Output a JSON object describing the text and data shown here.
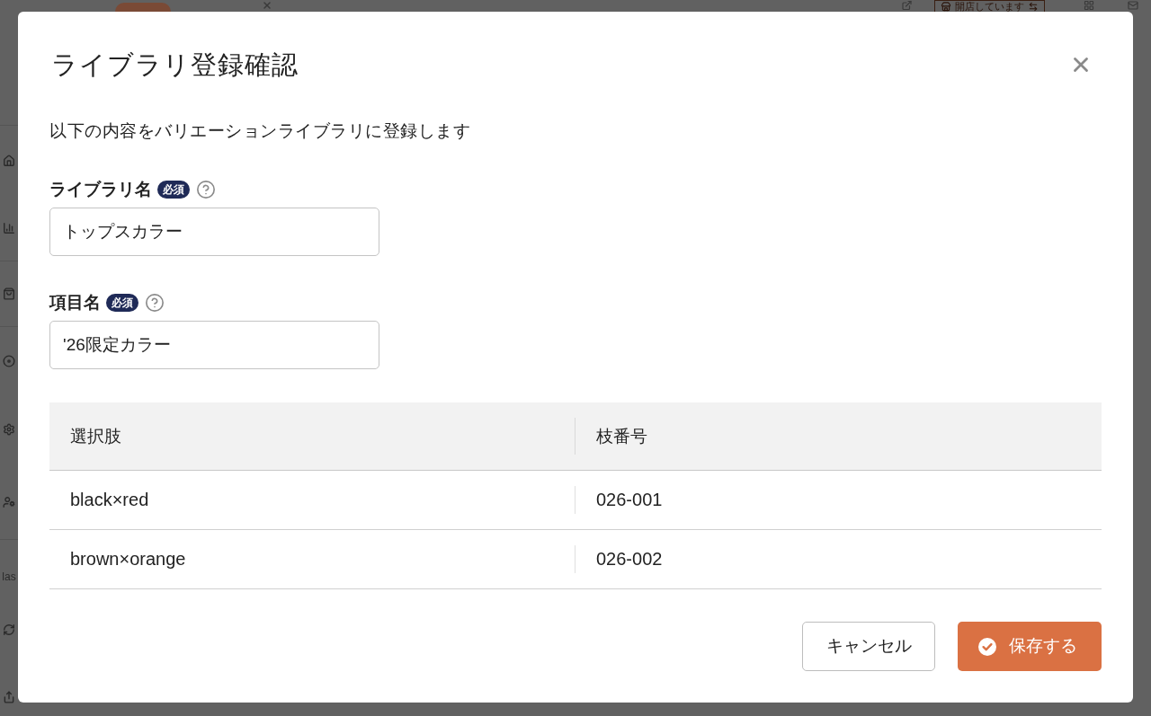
{
  "background": {
    "header": {
      "status_button": "開店しています"
    },
    "sidebar": {
      "label": "las"
    }
  },
  "dialog": {
    "title": "ライブラリ登録確認",
    "description": "以下の内容をバリエーションライブラリに登録します",
    "fields": [
      {
        "label": "ライブラリ名",
        "badge": "必須",
        "value": "トップスカラー"
      },
      {
        "label": "項目名",
        "badge": "必須",
        "value": "'26限定カラー"
      }
    ],
    "table": {
      "columns": [
        "選択肢",
        "枝番号"
      ],
      "rows": [
        [
          "black×red",
          "026-001"
        ],
        [
          "brown×orange",
          "026-002"
        ]
      ]
    },
    "buttons": [
      {
        "label": "キャンセル",
        "kind": "secondary"
      },
      {
        "label": "保存する",
        "kind": "primary"
      }
    ]
  }
}
